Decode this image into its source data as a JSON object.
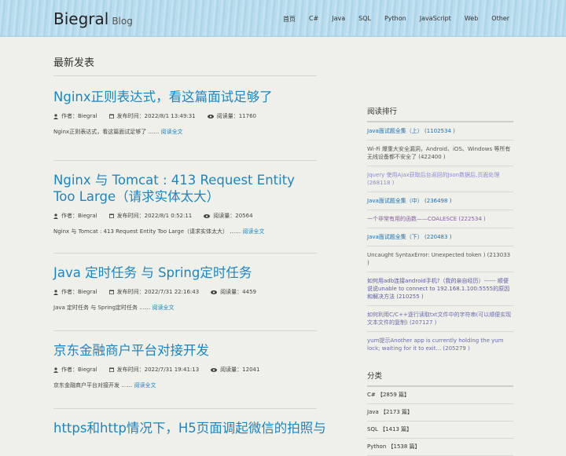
{
  "site": {
    "name": "Biegral",
    "subtitle": "Blog"
  },
  "nav": [
    "首页",
    "C#",
    "Java",
    "SQL",
    "Python",
    "JavaScript",
    "Web",
    "Other"
  ],
  "section_title": "最新发表",
  "posts": [
    {
      "title": "Nginx正则表达式，看这篇面试足够了",
      "author": "作者：Biegral",
      "time": "发布时间：2022/8/1 13:49:31",
      "views": "阅读量：11760",
      "excerpt": "Nginx正则表达式，看这篇面试足够了 ……",
      "readmore": "阅读全文"
    },
    {
      "title": "Nginx 与 Tomcat : 413 Request Entity Too Large（请求实体太大）",
      "author": "作者：Biegral",
      "time": "发布时间：2022/8/1 0:52:11",
      "views": "阅读量：20564",
      "excerpt": "Nginx 与 Tomcat : 413 Request Entity Too Large（请求实体太大） ……",
      "readmore": "阅读全文"
    },
    {
      "title": "Java 定时任务 与 Spring定时任务",
      "author": "作者：Biegral",
      "time": "发布时间：2022/7/31 22:16:43",
      "views": "阅读量：4459",
      "excerpt": "Java 定时任务 与 Spring定时任务 ……",
      "readmore": "阅读全文"
    },
    {
      "title": "京东金融商户平台对接开发",
      "author": "作者：Biegral",
      "time": "发布时间：2022/7/31 19:41:13",
      "views": "阅读量：12041",
      "excerpt": "京东金融商户平台对接开发 ……",
      "readmore": "阅读全文"
    },
    {
      "title": "https和http情况下，H5页面调起微信的拍照与",
      "author": "",
      "time": "",
      "views": "",
      "excerpt": "",
      "readmore": ""
    }
  ],
  "sidebar": {
    "ranking_title": "阅读排行",
    "ranking": [
      {
        "text": "Java面试题全集（上） (1102534 )",
        "color": "#1a6fb0"
      },
      {
        "text": "Wi-Fi 爆重大安全漏洞，Android、iOS、Windows 等所有无线设备都不安全了 (422400 )",
        "color": "#555555"
      },
      {
        "text": "Jquery 使用Ajax获取后台返回的Json数据后,页面处理 (268118 )",
        "color": "#8a8ad8"
      },
      {
        "text": "Java面试题全集（中） (236498 )",
        "color": "#1a6fb0"
      },
      {
        "text": "一个非常有用的函数——COALESCE (222534 )",
        "color": "#8a5aa8"
      },
      {
        "text": "Java面试题全集（下） (220483 )",
        "color": "#1a6fb0"
      },
      {
        "text": "Uncaught SyntaxError: Unexpected token ) (213033 )",
        "color": "#555555"
      },
      {
        "text": "如何用adb连接android手机?（我的亲自经历）------ 顺便说说unable to connect to 192.168.1.100:5555的原因和解决方法 (210255 )",
        "color": "#5a5aa8"
      },
      {
        "text": "如何利用C/C++逐行读取txt文件中的字符串(可以顺便实现文本文件的复制) (207127 )",
        "color": "#6a6ab0"
      },
      {
        "text": "yum提示Another app is currently holding the yum lock; waiting for it to exit... (205279 )",
        "color": "#6a6ab0"
      }
    ],
    "category_title": "分类",
    "categories": [
      "C# 【2859 篇】",
      "Java 【2173 篇】",
      "SQL 【1413 篇】",
      "Python 【1538 篇】"
    ]
  },
  "colors": {
    "accent": "#1a86c2",
    "background": "#f0f0ea",
    "header": "#b9dced"
  }
}
